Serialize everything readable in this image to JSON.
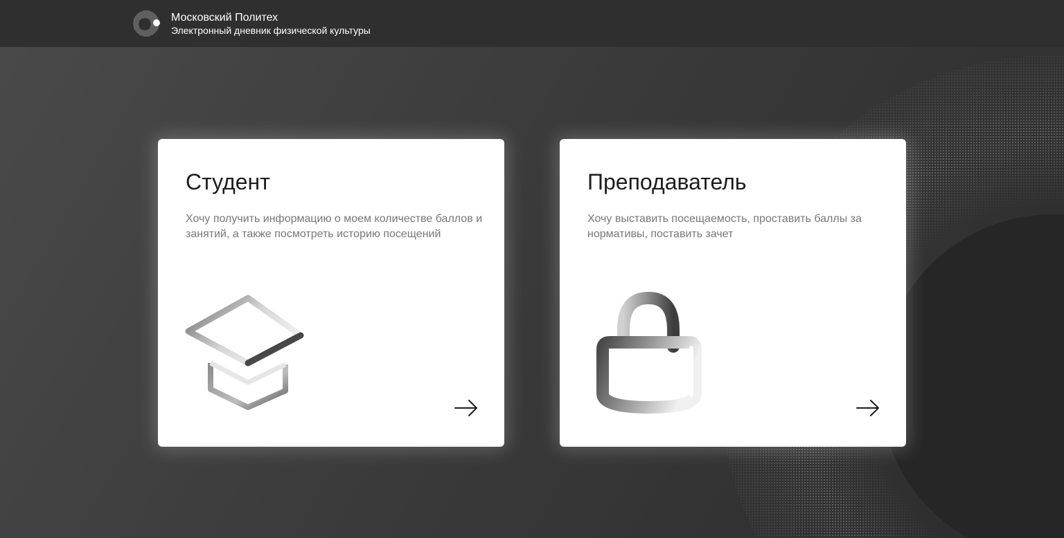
{
  "header": {
    "brand_name": "Московский Политех",
    "brand_subtitle": "Электронный дневник физической культуры",
    "logo_icon": "polytech-ring-logo-icon"
  },
  "roles": [
    {
      "title": "Студент",
      "description": "Хочу получить информацию о моем количестве баллов и занятий, а также посмотреть историю посещений",
      "icon": "graduation-cap-icon",
      "arrow_icon": "arrow-right-icon"
    },
    {
      "title": "Преподаватель",
      "description": "Хочу выставить посещаемость, проставить баллы за нормативы, поставить зачет",
      "icon": "padlock-icon",
      "arrow_icon": "arrow-right-icon"
    }
  ],
  "colors": {
    "header_bg": "#2f2f2f",
    "page_bg": "#3b3b3b",
    "card_bg": "#ffffff",
    "title_text": "#1d1d1d",
    "description_text": "#777777"
  }
}
